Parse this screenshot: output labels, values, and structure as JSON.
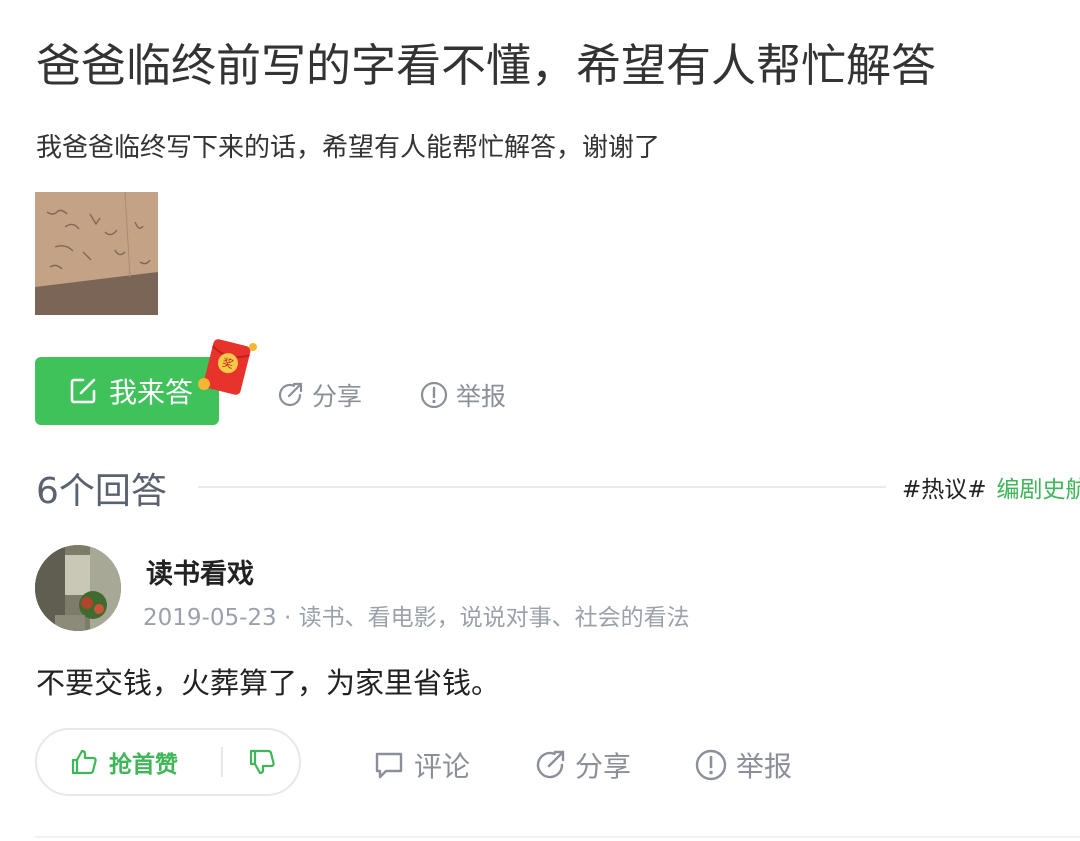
{
  "question": {
    "title": "爸爸临终前写的字看不懂，希望有人帮忙解答",
    "description": "我爸爸临终写下来的话，希望有人能帮忙解答，谢谢了"
  },
  "actions": {
    "answer_label": "我来答",
    "redpacket_char": "奖",
    "share_label": "分享",
    "report_label": "举报"
  },
  "answers_header": {
    "count_label": "6个回答",
    "hashtag": "#热议#",
    "topic": "编剧史航"
  },
  "answer": {
    "author": "读书看戏",
    "meta": "2019-05-23 · 读书、看电影，说说对事、社会的看法",
    "text": "不要交钱，火葬算了，为家里省钱。",
    "upvote_label": "抢首赞",
    "comment_label": "评论",
    "share_label": "分享",
    "report_label": "举报"
  },
  "colors": {
    "accent_green": "#3fc25a",
    "muted_gray": "#8a8f99",
    "redpacket": "#e8332c"
  },
  "icons": [
    "edit-icon",
    "share-icon",
    "report-icon",
    "thumb-up-icon",
    "thumb-down-icon",
    "comment-icon",
    "redpacket-icon"
  ]
}
